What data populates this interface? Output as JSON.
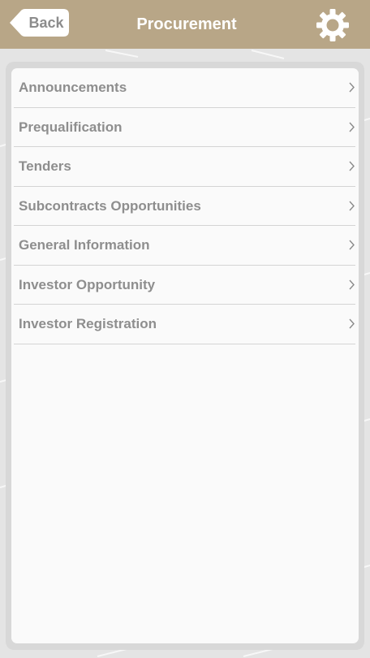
{
  "header": {
    "back_label": "Back",
    "title": "Procurement",
    "settings_icon": "gear-icon",
    "background_color": "#b8a687"
  },
  "menu": {
    "items": [
      {
        "label": "Announcements",
        "icon": "chevron-right-icon"
      },
      {
        "label": "Prequalification",
        "icon": "chevron-right-icon"
      },
      {
        "label": "Tenders",
        "icon": "chevron-right-icon"
      },
      {
        "label": "Subcontracts Opportunities",
        "icon": "chevron-right-icon"
      },
      {
        "label": "General Information",
        "icon": "chevron-right-icon"
      },
      {
        "label": "Investor Opportunity",
        "icon": "chevron-right-icon"
      },
      {
        "label": "Investor Registration",
        "icon": "chevron-right-icon"
      }
    ]
  }
}
